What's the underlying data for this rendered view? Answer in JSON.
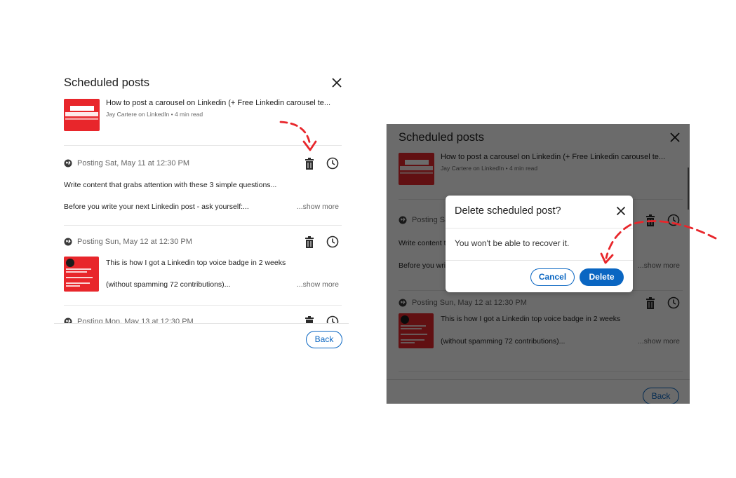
{
  "colors": {
    "accent": "#0a66c2",
    "annotation_arrow": "#e8262b",
    "thumbnail": "#e8262b"
  },
  "panel_title": "Scheduled posts",
  "article": {
    "title": "How to post a carousel on Linkedin (+ Free Linkedin carousel te...",
    "meta": "Jay Cartere on LinkedIn • 4 min read",
    "thumbnail_text": "How to post linkedin carousel post"
  },
  "posts": [
    {
      "time": "Posting Sat, May 11 at 12:30 PM",
      "line1": "Write content that grabs attention with these 3 simple questions...",
      "line2": "Before you write your next Linkedin post - ask yourself:...",
      "show_more": "...show more"
    },
    {
      "time": "Posting Sun, May 12 at 12:30 PM",
      "line1": "This is how I got a Linkedin top voice badge in 2 weeks",
      "line2": "(without spamming 72 contributions)...",
      "show_more": "...show more"
    },
    {
      "time": "Posting Mon, May 13 at 12:30 PM"
    }
  ],
  "back_label": "Back",
  "icons": {
    "close": "close-icon",
    "globe": "globe-icon",
    "trash": "trash-icon",
    "clock": "clock-icon"
  },
  "dialog": {
    "title": "Delete scheduled post?",
    "message": "You won't be able to recover it.",
    "cancel_label": "Cancel",
    "delete_label": "Delete"
  }
}
